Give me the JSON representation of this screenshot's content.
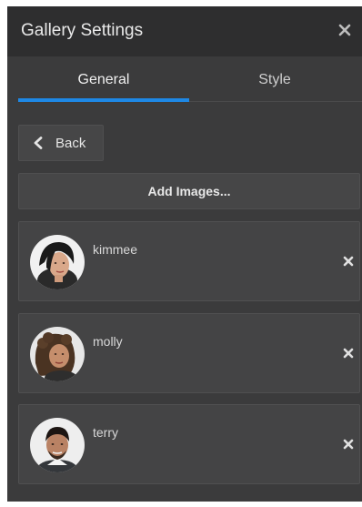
{
  "header": {
    "title": "Gallery Settings",
    "close_icon": "close-icon"
  },
  "tabs": [
    {
      "label": "General",
      "active": true
    },
    {
      "label": "Style",
      "active": false
    }
  ],
  "back_button": {
    "label": "Back",
    "icon": "chevron-left-icon"
  },
  "add_images_button": {
    "label": "Add Images..."
  },
  "images": [
    {
      "name": "kimmee",
      "remove_icon": "remove-icon"
    },
    {
      "name": "molly",
      "remove_icon": "remove-icon"
    },
    {
      "name": "terry",
      "remove_icon": "remove-icon"
    }
  ],
  "colors": {
    "panel_bg": "#3b3b3c",
    "header_bg": "#2e2e2f",
    "accent": "#1e88e5"
  }
}
